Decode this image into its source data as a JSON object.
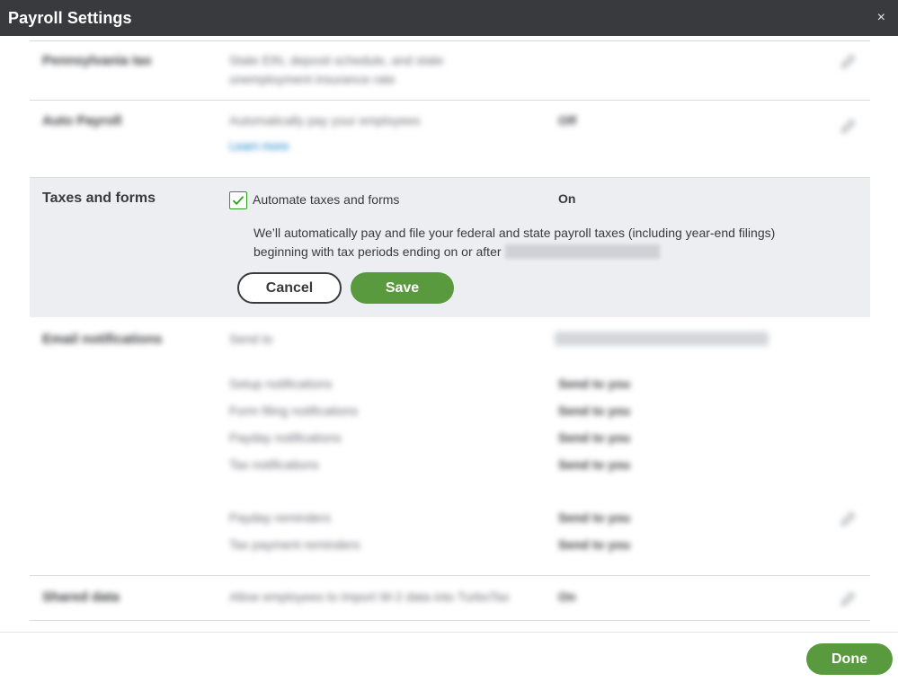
{
  "dialog": {
    "title": "Payroll Settings",
    "close_glyph": "×"
  },
  "rows": {
    "pennsylvania_tax": {
      "label": "Pennsylvania tax",
      "desc_line1": "State EIN, deposit schedule, and state",
      "desc_line2": "unemployment insurance rate"
    },
    "auto_payroll": {
      "label": "Auto Payroll",
      "desc": "Automatically pay your employees",
      "link": "Learn more",
      "value": "Off"
    },
    "email_notifications": {
      "label": "Email notifications",
      "sendto_label": "Send to",
      "items": [
        {
          "label": "Setup notifications",
          "value": "Send to you"
        },
        {
          "label": "Form filing notifications",
          "value": "Send to you"
        },
        {
          "label": "Payday notifications",
          "value": "Send to you"
        },
        {
          "label": "Tax notifications",
          "value": "Send to you"
        }
      ],
      "reminders": [
        {
          "label": "Payday reminders",
          "value": "Send to you"
        },
        {
          "label": "Tax payment reminders",
          "value": "Send to you"
        }
      ]
    },
    "shared_data": {
      "label": "Shared data",
      "desc": "Allow employees to import W-2 data into TurboTax",
      "value": "On"
    }
  },
  "taxes_forms": {
    "heading": "Taxes and forms",
    "checkbox_label": "Automate taxes and forms",
    "checked": true,
    "status": "On",
    "description": "We’ll automatically pay and file your federal and state payroll taxes (including year-end filings) beginning with tax periods ending on or after",
    "cancel_label": "Cancel",
    "save_label": "Save"
  },
  "footer": {
    "done_label": "Done"
  },
  "icons": {
    "pencil": "pencil-icon",
    "check": "check-icon",
    "close": "close-icon"
  },
  "colors": {
    "titlebar": "#393a3d",
    "accent_green": "#5a9a3f",
    "check_green": "#2ca01c",
    "panel_bg": "#eceef1",
    "link_blue": "#0077c5"
  }
}
